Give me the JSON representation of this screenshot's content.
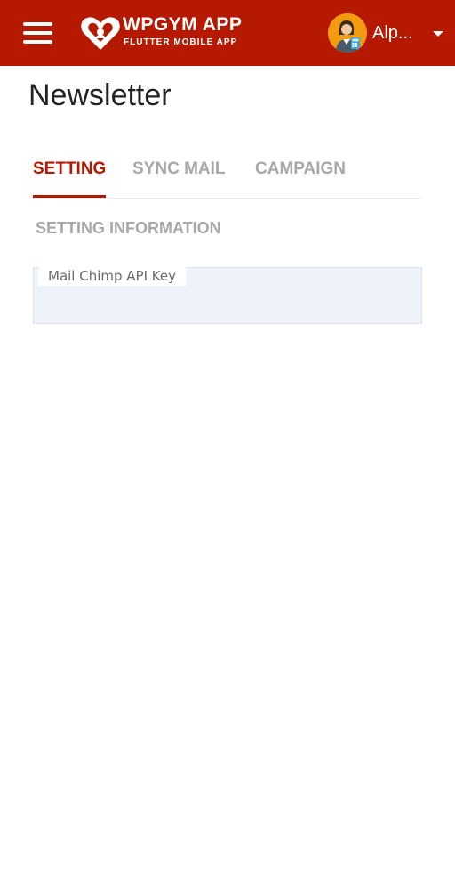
{
  "app": {
    "brand_title": "WPGYM APP",
    "brand_subtitle": "FLUTTER MOBILE APP",
    "user_name": "Alp...",
    "accent_color": "#b51a00",
    "icons": {
      "menu": "hamburger-menu-icon",
      "logo": "heart-logo-icon",
      "avatar": "user-avatar-icon",
      "dropdown": "caret-down-icon"
    }
  },
  "page": {
    "title": "Newsletter"
  },
  "tabs": [
    {
      "label": "SETTING",
      "active": true
    },
    {
      "label": "SYNC MAIL",
      "active": false
    },
    {
      "label": "CAMPAIGN",
      "active": false
    }
  ],
  "settings": {
    "section_heading": "SETTING INFORMATION",
    "api_key_label": "Mail Chimp API Key",
    "api_key_value": ""
  }
}
